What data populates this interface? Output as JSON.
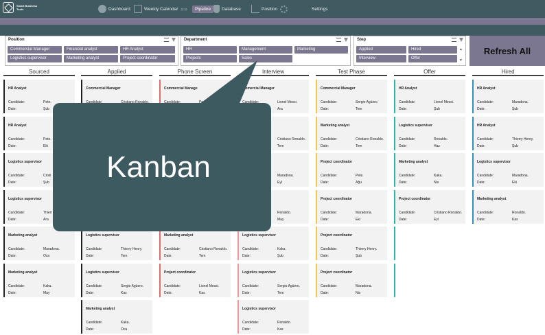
{
  "app": {
    "logo_text": "Smart Business Tools"
  },
  "nav": {
    "items": [
      {
        "label": "Dashboard",
        "icon": "pie-icon"
      },
      {
        "label": "Weekly Calendar",
        "icon": "calendar-icon"
      },
      {
        "label": "Pipeline",
        "icon": "arrows-icon",
        "active": true
      },
      {
        "label": "Database",
        "icon": "database-icon"
      },
      {
        "label": "Position",
        "icon": "chart-icon"
      },
      {
        "label": "Settings",
        "icon": "gear-icon"
      }
    ]
  },
  "filters": {
    "position": {
      "title": "Position",
      "options": [
        "Commercial Manager",
        "Financial analyst",
        "HR Analyst",
        "Logistics supervisor",
        "Marketing analyst",
        "Project coordinator"
      ]
    },
    "department": {
      "title": "Department",
      "options": [
        "HR",
        "Management",
        "Marketing",
        "Projects",
        "Sales"
      ]
    },
    "step": {
      "title": "Step",
      "options": [
        "Applied",
        "Hired",
        "Interview",
        "Offer"
      ]
    }
  },
  "refresh_label": "Refresh All",
  "labels": {
    "candidate": "Candidate:",
    "date": "Date:"
  },
  "callout": "Kanban",
  "columns": [
    {
      "title": "Sourced",
      "color": "#222222",
      "cards": [
        {
          "position": "HR Analyst",
          "candidate": "Pete.",
          "date": "Şub"
        },
        {
          "position": "HR Analyst",
          "candidate": "Pete.",
          "date": "Eki"
        },
        {
          "position": "Logistics supervisor",
          "candidate": "Cristi",
          "date": "Şub"
        },
        {
          "position": "Logistics supervisor",
          "candidate": "Thierr",
          "date": "Ara"
        },
        {
          "position": "Marketing analyst",
          "candidate": "Maradona.",
          "date": "Oca"
        },
        {
          "position": "Marketing analyst",
          "candidate": "Kaka.",
          "date": "May"
        }
      ]
    },
    {
      "title": "Applied",
      "color": "#222222",
      "cards": [
        {
          "position": "Commercial Manager",
          "candidate": "Cristiano Ronaldo.",
          "date": ""
        },
        {
          "position": "",
          "candidate": "",
          "date": ""
        },
        {
          "position": "",
          "candidate": "",
          "date": ""
        },
        {
          "position": "",
          "candidate": "",
          "date": ""
        },
        {
          "position": "Logistics supervisor",
          "candidate": "Thierry Henry.",
          "date": "Tem"
        },
        {
          "position": "Logistics supervisor",
          "candidate": "Sergio Agüero.",
          "date": "Kas"
        },
        {
          "position": "Marketing analyst",
          "candidate": "Kaka.",
          "date": "Oca"
        }
      ]
    },
    {
      "title": "Phone Screen",
      "color": "#e26b6b",
      "cards": [
        {
          "position": "Commercial Manage",
          "candidate": "Pe",
          "date": ""
        },
        {
          "position": "",
          "candidate": "",
          "date": ""
        },
        {
          "position": "",
          "candidate": "",
          "date": ""
        },
        {
          "position": "",
          "candidate": "",
          "date": ""
        },
        {
          "position": "Marketing analyst",
          "candidate": "Cristiano Ronaldo.",
          "date": "Tem"
        },
        {
          "position": "Project coordinator",
          "candidate": "Lionel Messi.",
          "date": "Kas"
        }
      ]
    },
    {
      "title": "Interview",
      "color": "#e89a9a",
      "cards": [
        {
          "position": "ommercial Manager",
          "candidate": "Lionel Messi.",
          "date": "Ara"
        },
        {
          "position": "",
          "candidate": "Cristiano Ronaldo.",
          "date": "Tem"
        },
        {
          "position": "",
          "candidate": "Maradona.",
          "date": "Eyl"
        },
        {
          "position": "",
          "candidate": "Ronaldo.",
          "date": "May"
        },
        {
          "position": "Logistics supervisor",
          "candidate": "Kaka.",
          "date": "Şub"
        },
        {
          "position": "Logistics supervisor",
          "candidate": "Sergio Agüero.",
          "date": "Tem"
        },
        {
          "position": "Logistics supervisor",
          "candidate": "Ronaldo.",
          "date": "Kas"
        }
      ]
    },
    {
      "title": "Test Phase",
      "color": "#f2c84b",
      "cards": [
        {
          "position": "Commercial Manager",
          "candidate": "Sergio Agüero.",
          "date": "Tem"
        },
        {
          "position": "Marketing analyst",
          "candidate": "Cristiano Ronaldo.",
          "date": "Tem"
        },
        {
          "position": "Project coordinator",
          "candidate": "Pete.",
          "date": "Ağu"
        },
        {
          "position": "Project coordinator",
          "candidate": "Maradona.",
          "date": "Eki"
        },
        {
          "position": "Project coordinator",
          "candidate": "Thierry Henry.",
          "date": "Şub"
        },
        {
          "position": "Project coordinator",
          "candidate": "Maradona.",
          "date": "Nis"
        }
      ]
    },
    {
      "title": "Offer",
      "color": "#2bb5a8",
      "cards": [
        {
          "position": "HR Analyst",
          "candidate": "Lionel Messi.",
          "date": "Şub"
        },
        {
          "position": "Logistics supervisor",
          "candidate": "Ronaldo.",
          "date": "Haz"
        },
        {
          "position": "Marketing analyst",
          "candidate": "Kaka.",
          "date": "Nis"
        },
        {
          "position": "Project coordinator",
          "candidate": "Cristiano Ronaldo.",
          "date": "Eyl"
        },
        {
          "position": "",
          "candidate": "",
          "date": "",
          "blank": true
        },
        {
          "position": "",
          "candidate": "",
          "date": "",
          "blank": true
        }
      ]
    },
    {
      "title": "Hired",
      "color": "#2f8fc0",
      "cards": [
        {
          "position": "HR Analyst",
          "candidate": "Maradona.",
          "date": "Şub"
        },
        {
          "position": "HR Analyst",
          "candidate": "Thierry Henry.",
          "date": "Şub"
        },
        {
          "position": "Logistics supervisor",
          "candidate": "Maradona.",
          "date": "Eki"
        },
        {
          "position": "Marketing analyst",
          "candidate": "Ronaldo.",
          "date": "Kas"
        }
      ]
    }
  ]
}
